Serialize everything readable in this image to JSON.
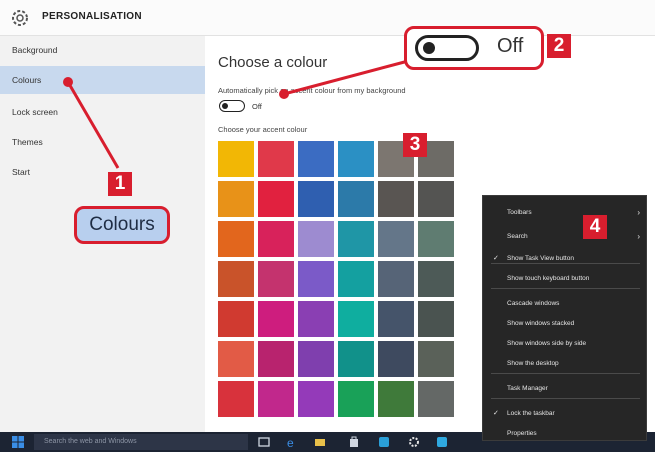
{
  "window": {
    "title": "PERSONALISATION"
  },
  "sidebar": {
    "items": [
      {
        "label": "Background",
        "active": false
      },
      {
        "label": "Colours",
        "active": true
      },
      {
        "label": "Lock screen",
        "active": false
      },
      {
        "label": "Themes",
        "active": false
      },
      {
        "label": "Start",
        "active": false
      }
    ]
  },
  "main": {
    "heading": "Choose a colour",
    "auto_label": "Automatically pick an accent colour from my background",
    "auto_toggle_state": "Off",
    "accent_label": "Choose your accent colour",
    "swatch_colors": [
      [
        "#f2b705",
        "#e0394a",
        "#3b6cc2",
        "#2b90c4",
        "#7c7670",
        "#6d6b66"
      ],
      [
        "#e89218",
        "#e1213f",
        "#2f5fb0",
        "#2c7aa9",
        "#595552",
        "#545452"
      ],
      [
        "#e2661d",
        "#d8225b",
        "#9d8bd0",
        "#1f96a6",
        "#647689",
        "#5f7c71"
      ],
      [
        "#c9532a",
        "#c4336e",
        "#7b5ac8",
        "#14a0a0",
        "#566477",
        "#4d5a57"
      ],
      [
        "#d03a30",
        "#ce1d7e",
        "#8a3fb3",
        "#0fae9f",
        "#45546a",
        "#4a5350"
      ],
      [
        "#e25b46",
        "#b8236e",
        "#7f3fae",
        "#11918a",
        "#3e4a5f",
        "#5a6159"
      ],
      [
        "#d8323c",
        "#c1288c",
        "#943ab9",
        "#19a158",
        "#3f7a3a",
        "#646866"
      ]
    ]
  },
  "callouts": {
    "label_1": "Colours",
    "toggle_label": "Off",
    "badge_1": "1",
    "badge_2": "2",
    "badge_3": "3",
    "badge_4": "4"
  },
  "context_menu": {
    "items": [
      {
        "label": "Toolbars",
        "submenu": true,
        "checked": false
      },
      {
        "label": "Search",
        "submenu": true,
        "checked": false
      },
      {
        "label": "Show Task View button",
        "submenu": false,
        "checked": true
      },
      {
        "label": "Show touch keyboard button",
        "submenu": false,
        "checked": false
      },
      {
        "label": "Cascade windows",
        "submenu": false,
        "checked": false
      },
      {
        "label": "Show windows stacked",
        "submenu": false,
        "checked": false
      },
      {
        "label": "Show windows side by side",
        "submenu": false,
        "checked": false
      },
      {
        "label": "Show the desktop",
        "submenu": false,
        "checked": false
      },
      {
        "label": "Task Manager",
        "submenu": false,
        "checked": false
      },
      {
        "label": "Lock the taskbar",
        "submenu": false,
        "checked": true
      },
      {
        "label": "Properties",
        "submenu": false,
        "checked": false
      }
    ],
    "check_glyph": "✓",
    "arrow_glyph": "›"
  },
  "taskbar": {
    "search_placeholder": "Search the web and Windows",
    "icons": [
      "task-view-icon",
      "edge-icon",
      "file-explorer-icon",
      "store-icon",
      "skype-icon",
      "settings-icon",
      "browser-icon"
    ]
  },
  "colors": {
    "accent_red": "#d81e2e",
    "selected_nav": "#c8d9ee",
    "callout_label_bg": "#b8cfee",
    "taskbar_bg": "#1c2433",
    "menu_bg": "#262626"
  }
}
